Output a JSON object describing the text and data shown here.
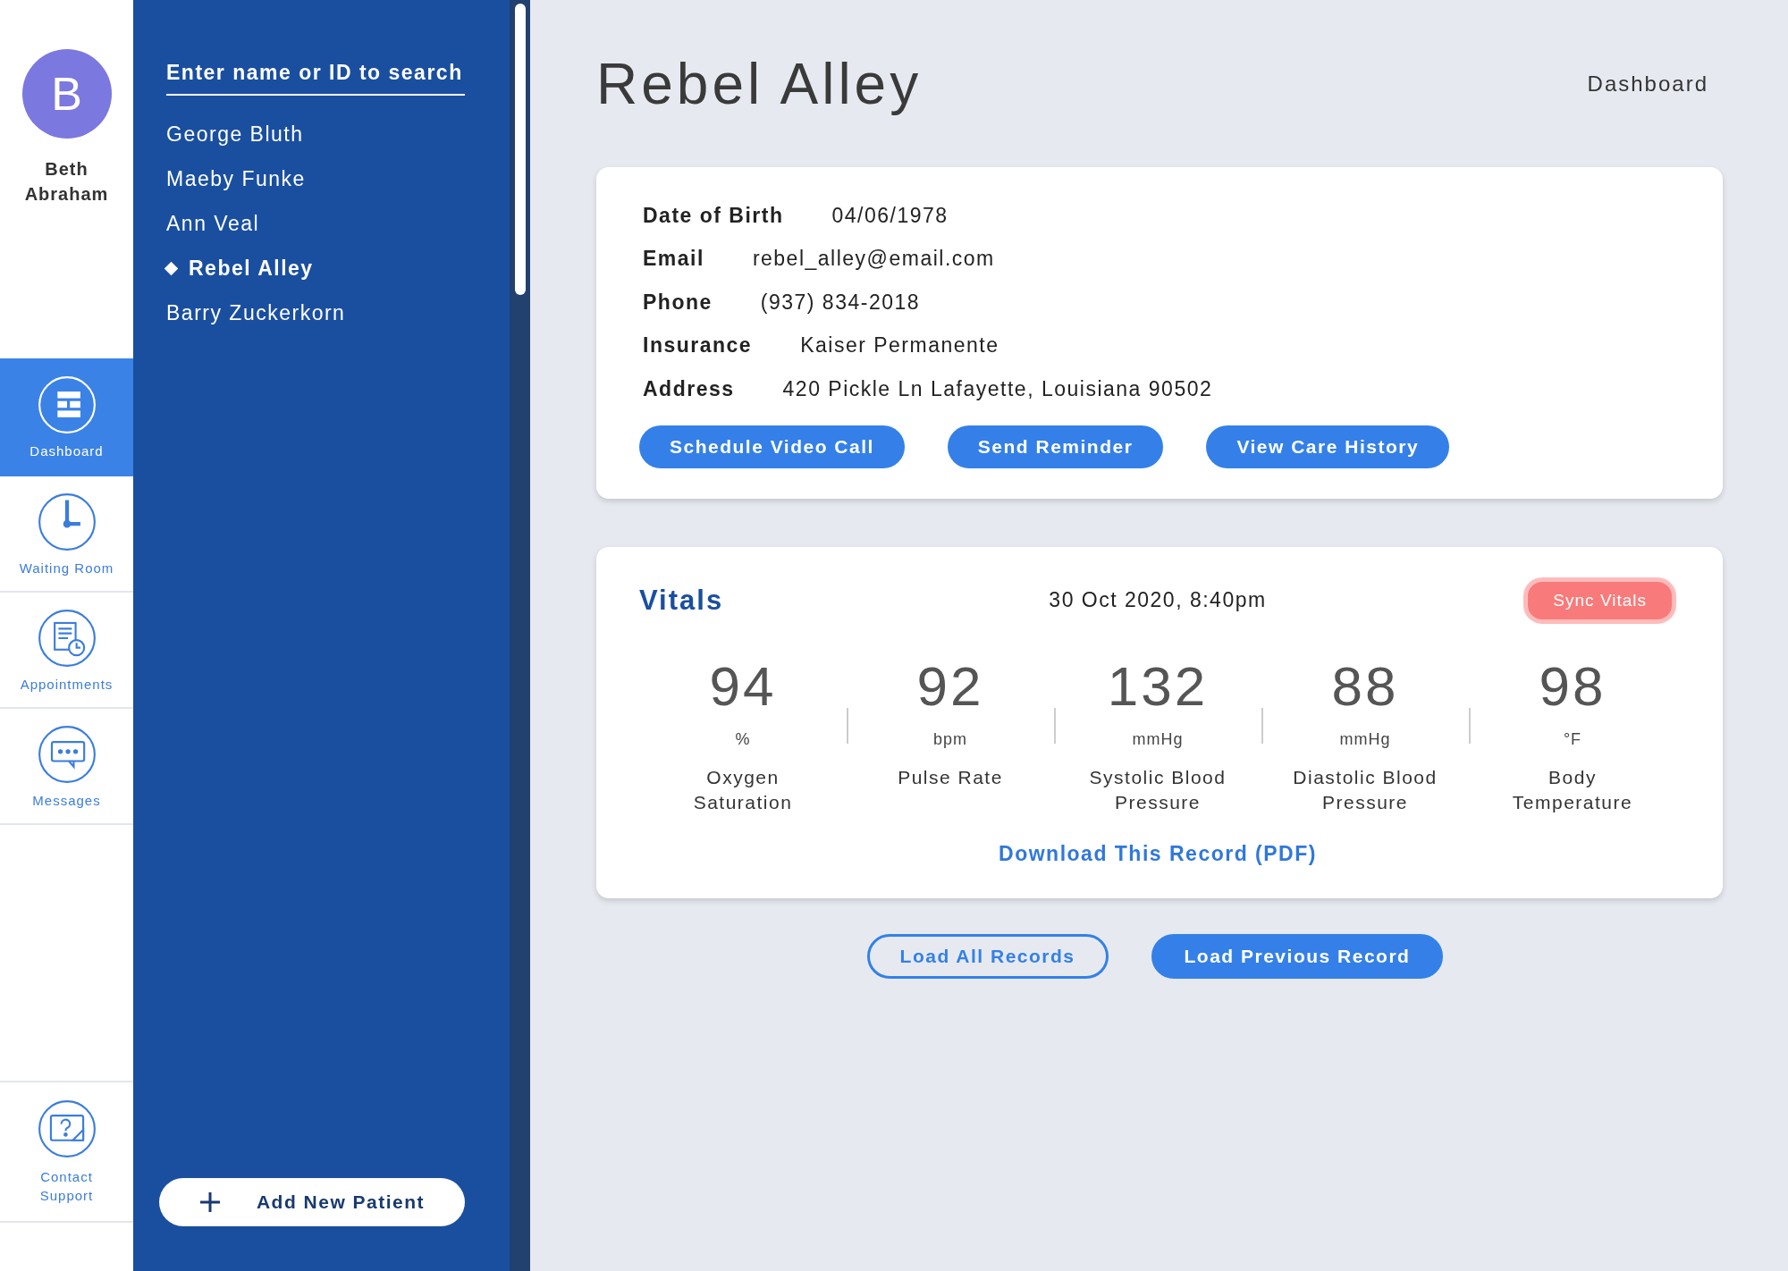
{
  "user": {
    "initial": "B",
    "name": "Beth Abraham"
  },
  "nav": [
    {
      "label": "Dashboard",
      "kind": "dashboard",
      "selected": true
    },
    {
      "label": "Waiting Room",
      "kind": "clock",
      "selected": false
    },
    {
      "label": "Appointments",
      "kind": "appointments",
      "selected": false
    },
    {
      "label": "Messages",
      "kind": "messages",
      "selected": false
    }
  ],
  "support": {
    "label": "Contact Support"
  },
  "patients": {
    "search_placeholder": "Enter name or ID to search",
    "items": [
      {
        "name": "George Bluth",
        "selected": false
      },
      {
        "name": "Maeby Funke",
        "selected": false
      },
      {
        "name": "Ann Veal",
        "selected": false
      },
      {
        "name": "Rebel Alley",
        "selected": true
      },
      {
        "name": "Barry Zuckerkorn",
        "selected": false
      }
    ],
    "add_button": "Add New Patient"
  },
  "header": {
    "title": "Rebel Alley",
    "breadcrumb": "Dashboard"
  },
  "info": {
    "rows": [
      {
        "label": "Date of Birth",
        "value": "04/06/1978"
      },
      {
        "label": "Email",
        "value": "rebel_alley@email.com"
      },
      {
        "label": "Phone",
        "value": "(937) 834-2018"
      },
      {
        "label": "Insurance",
        "value": "Kaiser Permanente"
      },
      {
        "label": "Address",
        "value": "420 Pickle Ln Lafayette, Louisiana 90502"
      }
    ],
    "buttons": [
      "Schedule Video Call",
      "Send Reminder",
      "View Care History"
    ]
  },
  "vitals": {
    "title": "Vitals",
    "timestamp": "30 Oct 2020, 8:40pm",
    "sync_button": "Sync Vitals",
    "items": [
      {
        "value": "94",
        "unit": "%",
        "label": "Oxygen Saturation"
      },
      {
        "value": "92",
        "unit": "bpm",
        "label": "Pulse Rate"
      },
      {
        "value": "132",
        "unit": "mmHg",
        "label": "Systolic Blood Pressure"
      },
      {
        "value": "88",
        "unit": "mmHg",
        "label": "Diastolic Blood Pressure"
      },
      {
        "value": "98",
        "unit": "°F",
        "label": "Body Temperature"
      }
    ],
    "download_link": "Download This Record (PDF)"
  },
  "actions": [
    {
      "label": "Load All Records",
      "kind": "outline"
    },
    {
      "label": "Load Previous Record",
      "kind": "filled"
    }
  ]
}
